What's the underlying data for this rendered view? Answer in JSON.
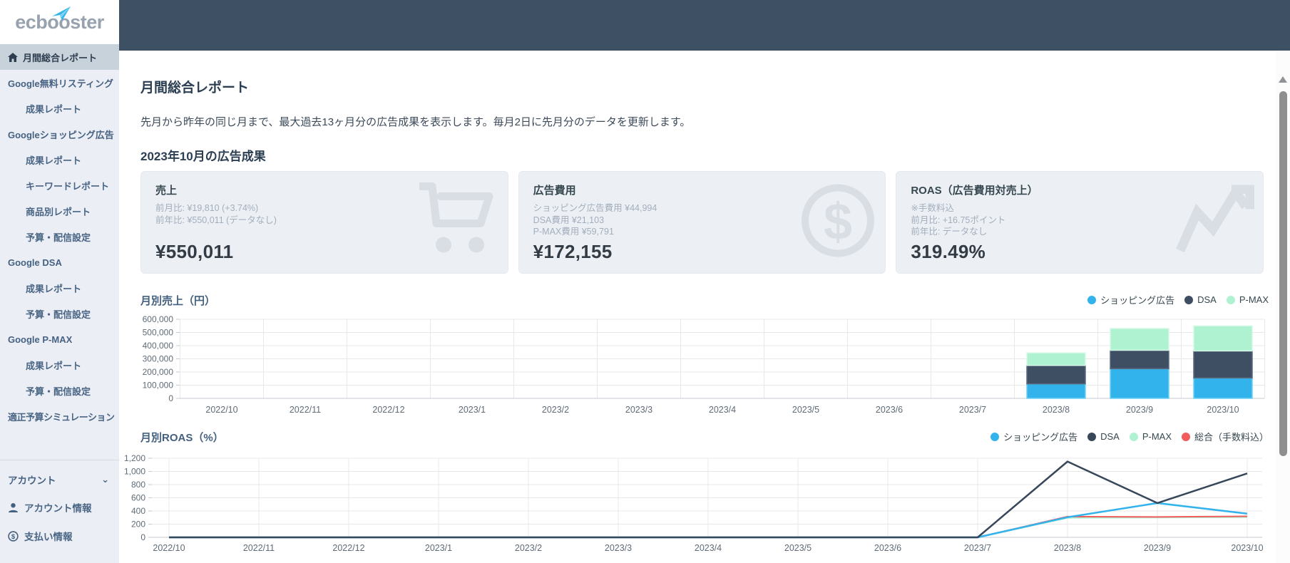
{
  "brand": {
    "logo_left": "ecb",
    "logo_o": "o",
    "logo_right": "oster",
    "plane_color": "#35b5ea"
  },
  "sidebar": {
    "items": [
      {
        "label": "月間総合レポート",
        "type": "active",
        "icon": "home-icon"
      },
      {
        "label": "Google無料リスティング",
        "type": "section"
      },
      {
        "label": "成果レポート",
        "type": "link"
      },
      {
        "label": "Googleショッピング広告",
        "type": "section"
      },
      {
        "label": "成果レポート",
        "type": "link"
      },
      {
        "label": "キーワードレポート",
        "type": "link"
      },
      {
        "label": "商品別レポート",
        "type": "link"
      },
      {
        "label": "予算・配信設定",
        "type": "link"
      },
      {
        "label": "Google DSA",
        "type": "section"
      },
      {
        "label": "成果レポート",
        "type": "link"
      },
      {
        "label": "予算・配信設定",
        "type": "link"
      },
      {
        "label": "Google P-MAX",
        "type": "section"
      },
      {
        "label": "成果レポート",
        "type": "link"
      },
      {
        "label": "予算・配信設定",
        "type": "link"
      },
      {
        "label": "適正予算シミュレーション",
        "type": "toplink"
      }
    ],
    "account": {
      "label": "アカウント",
      "chevron": "⌄",
      "items": [
        {
          "label": "アカウント情報",
          "icon": "user-icon"
        },
        {
          "label": "支払い情報",
          "icon": "payment-icon"
        }
      ]
    }
  },
  "page": {
    "title": "月間総合レポート",
    "description": "先月から昨年の同じ月まで、最大過去13ヶ月分の広告成果を表示します。毎月2日に先月分のデータを更新します。",
    "section_title": "2023年10月の広告成果"
  },
  "cards": [
    {
      "id": "sales",
      "title": "売上",
      "icon": "cart-icon",
      "lines": [
        "前月比: ¥19,810 (+3.74%)",
        "前年比: ¥550,011 (データなし)"
      ],
      "value": "¥550,011"
    },
    {
      "id": "ad-cost",
      "title": "広告費用",
      "icon": "dollar-icon",
      "lines": [
        "ショッピング広告費用 ¥44,994",
        "DSA費用 ¥21,103",
        "P-MAX費用 ¥59,791"
      ],
      "value": "¥172,155"
    },
    {
      "id": "roas",
      "title": "ROAS（広告費用対売上）",
      "icon": "trend-icon",
      "lines": [
        "※手数料込",
        "前月比: +16.75ポイント",
        "前年比: データなし"
      ],
      "value": "319.49%"
    }
  ],
  "chart_data": [
    {
      "type": "bar",
      "stacked": true,
      "title": "月別売上（円）",
      "categories": [
        "2022/10",
        "2022/11",
        "2022/12",
        "2023/1",
        "2023/2",
        "2023/3",
        "2023/4",
        "2023/5",
        "2023/6",
        "2023/7",
        "2023/8",
        "2023/9",
        "2023/10"
      ],
      "series": [
        {
          "name": "ショッピング広告",
          "color": "#33b3eb",
          "stroke": "#6fd0f5",
          "values": [
            0,
            0,
            0,
            0,
            0,
            0,
            0,
            0,
            0,
            0,
            110000,
            225000,
            155000
          ]
        },
        {
          "name": "DSA",
          "color": "#3e4f63",
          "stroke": "#5a6b80",
          "values": [
            0,
            0,
            0,
            0,
            0,
            0,
            0,
            0,
            0,
            0,
            140000,
            140000,
            205000
          ]
        },
        {
          "name": "P-MAX",
          "color": "#aef2d2",
          "stroke": "#d6f8e8",
          "values": [
            0,
            0,
            0,
            0,
            0,
            0,
            0,
            0,
            0,
            0,
            95000,
            165000,
            190011
          ]
        }
      ],
      "ylim": [
        0,
        600000
      ],
      "ytick_step": 100000,
      "grid": true,
      "legend_position": "top-right"
    },
    {
      "type": "line",
      "title": "月別ROAS（%）",
      "categories": [
        "2022/10",
        "2022/11",
        "2022/12",
        "2023/1",
        "2023/2",
        "2023/3",
        "2023/4",
        "2023/5",
        "2023/6",
        "2023/7",
        "2023/8",
        "2023/9",
        "2023/10"
      ],
      "series": [
        {
          "name": "P-MAX",
          "color": "#aef2d2",
          "stroke_width": 2,
          "values": [
            0,
            0,
            0,
            0,
            0,
            0,
            0,
            0,
            0,
            0,
            295,
            300,
            305
          ]
        },
        {
          "name": "総合（手数料込）",
          "color": "#f25c5c",
          "stroke_width": 2,
          "values": [
            0,
            0,
            0,
            0,
            0,
            0,
            0,
            0,
            0,
            0,
            315,
            310,
            319.49
          ]
        },
        {
          "name": "ショッピング広告",
          "color": "#33b3eb",
          "stroke_width": 2.5,
          "values": [
            0,
            0,
            0,
            0,
            0,
            0,
            0,
            0,
            0,
            0,
            305,
            520,
            360
          ]
        },
        {
          "name": "DSA",
          "color": "#37475a",
          "stroke_width": 2.5,
          "values": [
            0,
            0,
            0,
            0,
            0,
            0,
            0,
            0,
            0,
            0,
            1150,
            520,
            970
          ]
        }
      ],
      "legend_order": [
        "ショッピング広告",
        "DSA",
        "P-MAX",
        "総合（手数料込）"
      ],
      "ylim": [
        0,
        1200
      ],
      "ytick_step": 200,
      "grid": true,
      "legend_position": "top-right"
    }
  ],
  "colors": {
    "header": "#3e5064",
    "sidebar_bg": "#ebeff5",
    "active_bg": "#c8d2db",
    "accent_blue": "#33b3eb"
  }
}
